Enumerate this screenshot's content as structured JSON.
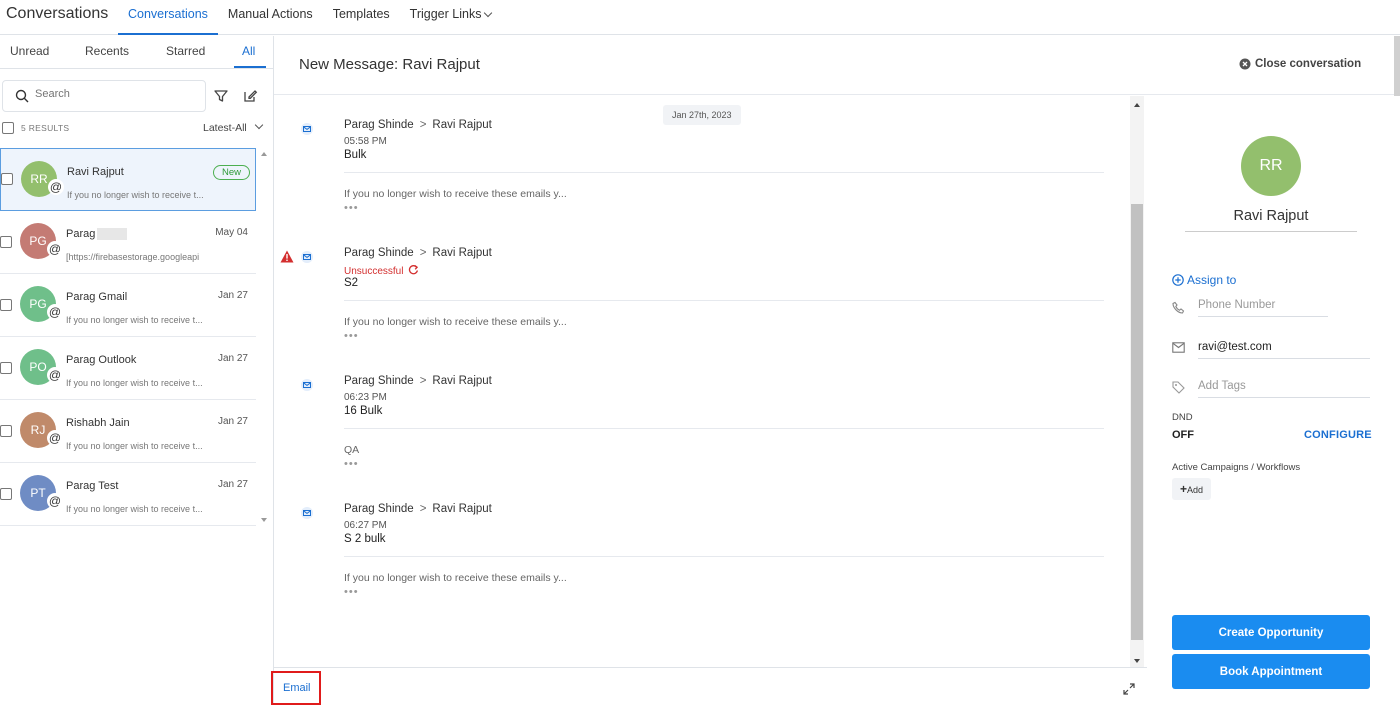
{
  "header": {
    "app_title": "Conversations",
    "nav": [
      {
        "label": "Conversations",
        "active": true
      },
      {
        "label": "Manual Actions"
      },
      {
        "label": "Templates"
      },
      {
        "label": "Trigger Links"
      }
    ]
  },
  "filters": {
    "tabs": [
      "Unread",
      "Recents",
      "Starred",
      "All"
    ],
    "active_tab": "All",
    "search_placeholder": "Search",
    "results": "5 RESULTS",
    "sort": "Latest-All"
  },
  "conversations": [
    {
      "initials": "RR",
      "name": "Ravi Rajput",
      "badge": "New",
      "date": "",
      "preview": "If you no longer wish to receive t...",
      "color": "#93bf6d"
    },
    {
      "initials": "PG",
      "name": "Parag",
      "date": "May 04",
      "preview": "[https://firebasestorage.googleapi",
      "color": "#c47b74"
    },
    {
      "initials": "PG",
      "name": "Parag Gmail",
      "date": "Jan 27",
      "preview": "If you no longer wish to receive t...",
      "color": "#6fbf8a"
    },
    {
      "initials": "PO",
      "name": "Parag Outlook",
      "date": "Jan 27",
      "preview": "If you no longer wish to receive t...",
      "color": "#6fbf8a"
    },
    {
      "initials": "RJ",
      "name": "Rishabh Jain",
      "date": "Jan 27",
      "preview": "If you no longer wish to receive t...",
      "color": "#c08a6a"
    },
    {
      "initials": "PT",
      "name": "Parag Test",
      "date": "Jan 27",
      "preview": "If you no longer wish to receive t...",
      "color": "#6f8cc4"
    }
  ],
  "thread": {
    "title": "New Message: Ravi Rajput",
    "close_label": "Close conversation",
    "date_chip": "Jan 27th, 2023",
    "messages": [
      {
        "from": "Parag Shinde",
        "to": "Ravi Rajput",
        "time": "05:58 PM",
        "subject": "Bulk",
        "body": "If you no longer wish to receive these emails y...",
        "dots": "•••"
      },
      {
        "from": "Parag Shinde",
        "to": "Ravi Rajput",
        "time": "Unsuccessful",
        "subject": "S2",
        "body": "If you no longer wish to receive these emails y...",
        "dots": "•••"
      },
      {
        "from": "Parag Shinde",
        "to": "Ravi Rajput",
        "time": "06:23 PM",
        "subject": "16 Bulk",
        "body": "QA",
        "dots": "•••"
      },
      {
        "from": "Parag Shinde",
        "to": "Ravi Rajput",
        "time": "06:27 PM",
        "subject": "S 2 bulk",
        "body": "If you no longer wish to receive these emails y...",
        "dots": "•••"
      }
    ],
    "arrow": ">",
    "compose_tab": "Email"
  },
  "contact": {
    "initials": "RR",
    "name": "Ravi Rajput",
    "assign": "Assign to",
    "phone_placeholder": "Phone Number",
    "email": "ravi@test.com",
    "tags_placeholder": "Add Tags",
    "dnd_label": "DND",
    "dnd_value": "OFF",
    "configure": "CONFIGURE",
    "campaigns_label": "Active Campaigns / Workflows",
    "add": "Add",
    "create_opportunity": "Create Opportunity",
    "book_appointment": "Book Appointment"
  }
}
